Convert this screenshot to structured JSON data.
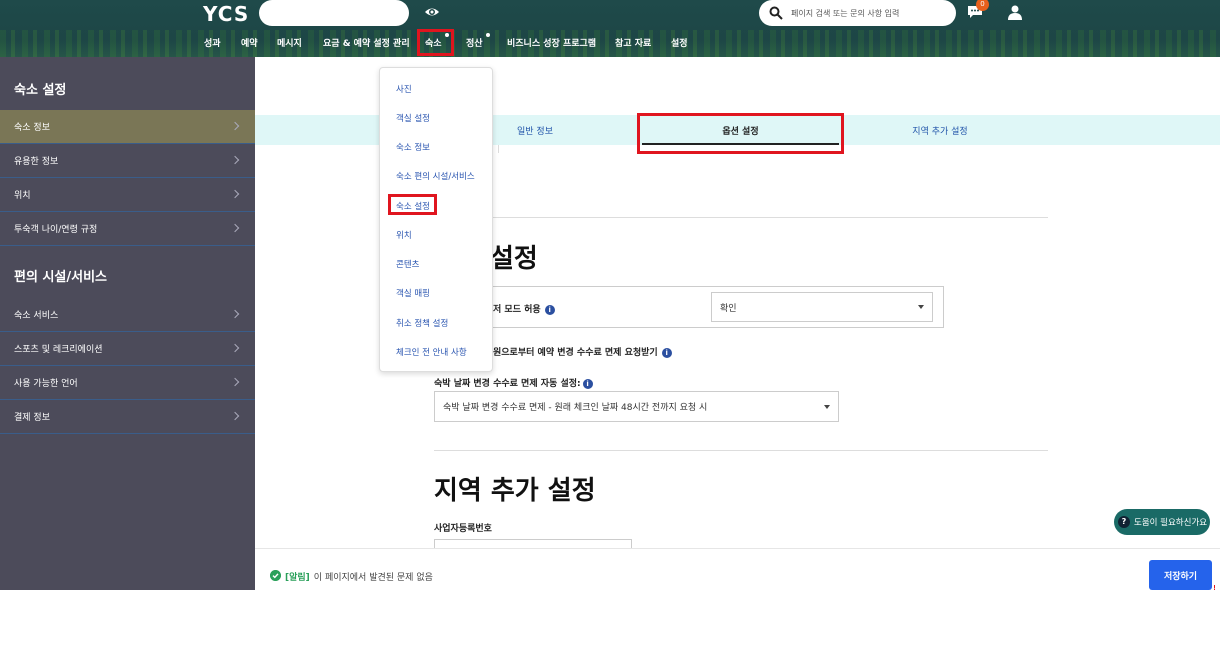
{
  "header": {
    "logo": "YCS",
    "search_placeholder": "페이지 검색 또는 문의 사항 입력",
    "notification_count": "0",
    "nav": [
      {
        "label": "성과"
      },
      {
        "label": "예약"
      },
      {
        "label": "메시지"
      },
      {
        "label": "요금 & 예약 설정 관리"
      },
      {
        "label": "숙소"
      },
      {
        "label": "정산"
      },
      {
        "label": "비즈니스 성장 프로그램"
      },
      {
        "label": "참고 자료"
      },
      {
        "label": "설정"
      }
    ]
  },
  "sidebar": {
    "section1_title": "숙소 설정",
    "section1_items": [
      {
        "label": "숙소 정보"
      },
      {
        "label": "유용한 정보"
      },
      {
        "label": "위치"
      },
      {
        "label": "투숙객 나이/연령 규정"
      }
    ],
    "section2_title": "편의 시설/서비스",
    "section2_items": [
      {
        "label": "숙소 서비스"
      },
      {
        "label": "스포츠 및 레크리에이션"
      },
      {
        "label": "사용 가능한 언어"
      },
      {
        "label": "결제 정보"
      }
    ]
  },
  "dropdown": {
    "items": [
      {
        "label": "사진"
      },
      {
        "label": "객실 설정"
      },
      {
        "label": "숙소 정보"
      },
      {
        "label": "숙소 편의 시설/서비스"
      },
      {
        "label": "숙소 설정"
      },
      {
        "label": "위치"
      },
      {
        "label": "콘텐츠"
      },
      {
        "label": "객실 매핑"
      },
      {
        "label": "취소 정책 설정"
      },
      {
        "label": "체크인 전 안내 사항"
      }
    ]
  },
  "tabs": [
    {
      "label": "일반 정보"
    },
    {
      "label": "옵션 설정"
    },
    {
      "label": "지역 추가 설정"
    }
  ],
  "main": {
    "option_title_fragment": "설정",
    "row1_label_fragment": "저 모드 허용",
    "row1_select_value": "확인",
    "row2_label_fragment": "원으로부터 예약 변경 수수료 면제 요청받기",
    "auto_waiver_label": "숙박 날짜 변경 수수료 면제 자동 설정:",
    "auto_waiver_value": "숙박 날짜 변경 수수료 면제 - 원래 체크인 날짜 48시간 전까지 요청 시",
    "region_title": "지역 추가 설정",
    "biz_reg_label": "사업자등록번호"
  },
  "footer": {
    "alert_tag": "[알림]",
    "alert_msg": "이 페이지에서 발견된 문제 없음",
    "save_label": "저장하기"
  },
  "help": {
    "label": "도움이 필요하신가요"
  },
  "colors": {
    "header_bg": "#1d4646",
    "sidebar_bg": "#4c4b5a",
    "sidebar_active": "#7a7656",
    "tabbar_bg": "#dff7f7",
    "link_blue": "#2a55b0",
    "primary": "#2563eb",
    "highlight_red": "#e0151f",
    "success": "#2aa05a"
  }
}
